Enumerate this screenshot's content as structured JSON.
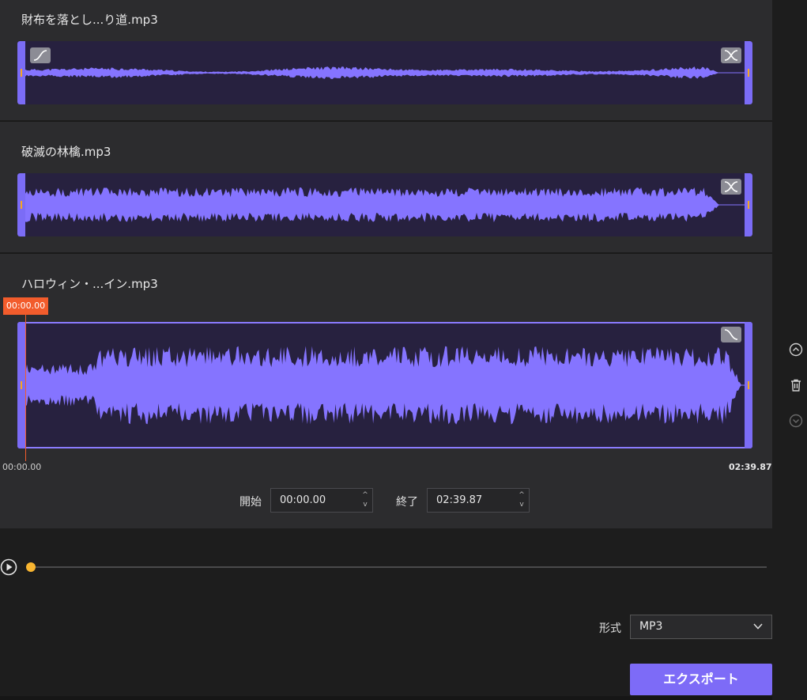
{
  "tracks": [
    {
      "title": "財布を落とし...り道.mp3",
      "fade_in": true,
      "fade_out": true,
      "amp": 0.18,
      "seed": 11,
      "tail": 0.965
    },
    {
      "title": "破滅の林檎.mp3",
      "fade_in": false,
      "fade_out": true,
      "amp": 0.55,
      "seed": 29,
      "tail": 0.965
    },
    {
      "title": "ハロウィン・...イン.mp3",
      "fade_in": false,
      "fade_out": "single",
      "amp": 0.62,
      "seed": 47,
      "tail": 0.995
    }
  ],
  "playhead": {
    "label": "00:00.00"
  },
  "timeline": {
    "start": "00:00.00",
    "end": "02:39.87"
  },
  "range": {
    "start_label": "開始",
    "start_value": "00:00.00",
    "end_label": "終了",
    "end_value": "02:39.87"
  },
  "player": {
    "progress": 0.0
  },
  "format": {
    "label": "形式",
    "value": "MP3"
  },
  "export": {
    "label": "エクスポート"
  },
  "colors": {
    "accent": "#7d6bf7",
    "wave": "#8574ff",
    "playhead": "#f25c2c",
    "dot": "#f8b530"
  },
  "icons": [
    "fade-in-icon",
    "crossfade-icon",
    "fade-out-icon",
    "move-up-icon",
    "trash-icon",
    "move-down-icon",
    "play-icon",
    "chevron-down-icon"
  ]
}
